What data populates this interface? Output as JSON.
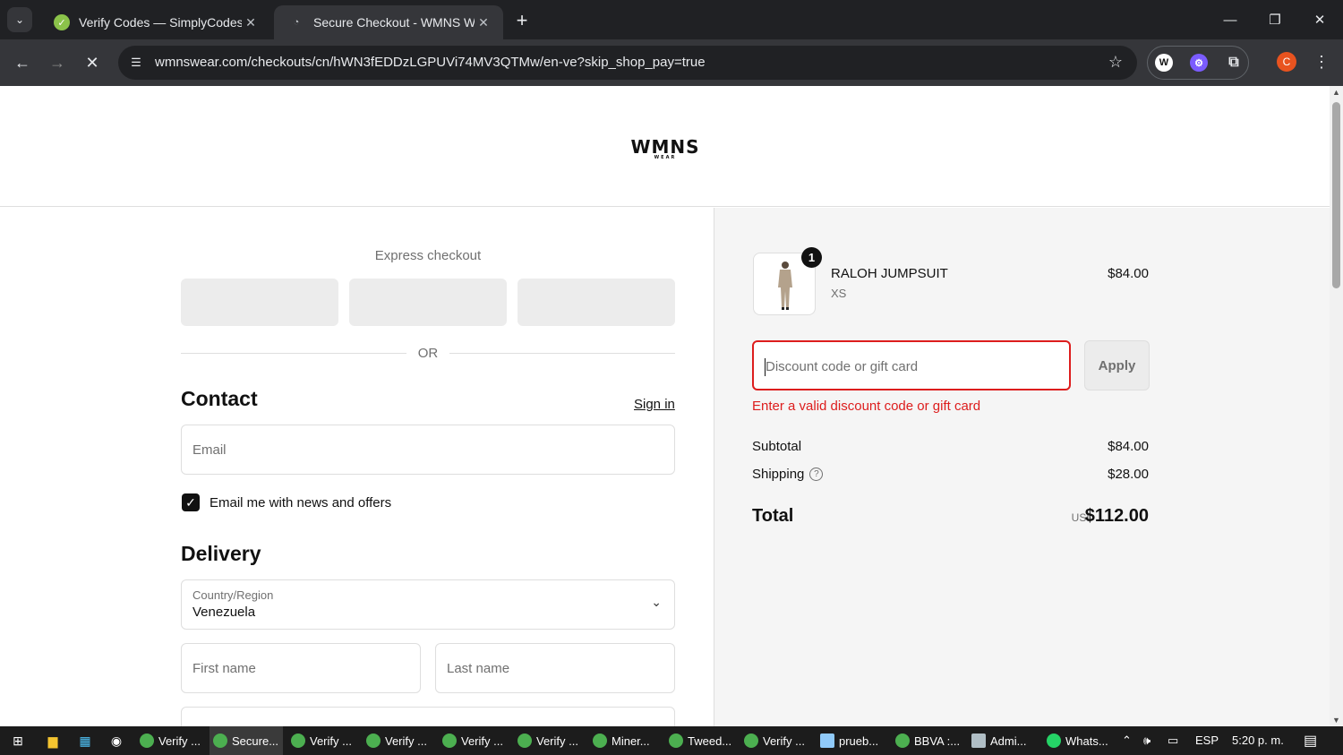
{
  "browser": {
    "tabs": [
      {
        "title": "Verify Codes — SimplyCodes",
        "active": false
      },
      {
        "title": "Secure Checkout - WMNS WEA",
        "active": true
      }
    ],
    "url": "wmnswear.com/checkouts/cn/hWN3fEDDzLGPUVi74MV3QTMw/en-ve?skip_shop_pay=true",
    "profile_initial": "C"
  },
  "store": {
    "logo": "WMNS",
    "logo_sub": "WEAR"
  },
  "express": {
    "title": "Express checkout",
    "or": "OR"
  },
  "contact": {
    "heading": "Contact",
    "signin": "Sign in",
    "email_placeholder": "Email",
    "newsletter_label": "Email me with news and offers",
    "newsletter_checked": true
  },
  "delivery": {
    "heading": "Delivery",
    "country_label": "Country/Region",
    "country_value": "Venezuela",
    "first_name_placeholder": "First name",
    "last_name_placeholder": "Last name"
  },
  "order": {
    "item": {
      "name": "RALOH JUMPSUIT",
      "variant": "XS",
      "price": "$84.00",
      "quantity": "1"
    },
    "discount_placeholder": "Discount code or gift card",
    "apply_label": "Apply",
    "error": "Enter a valid discount code or gift card",
    "subtotal_label": "Subtotal",
    "subtotal_value": "$84.00",
    "shipping_label": "Shipping",
    "shipping_value": "$28.00",
    "total_label": "Total",
    "total_currency": "USD",
    "total_value": "$112.00"
  },
  "taskbar": {
    "apps": [
      "Verify ...",
      "Secure...",
      "Verify ...",
      "Verify ...",
      "Verify ...",
      "Verify ...",
      "Miner...",
      "Tweed...",
      "Verify ...",
      "prueb...",
      "BBVA :...",
      "Admi...",
      "Whats..."
    ],
    "active_index": 1,
    "language": "ESP",
    "time": "5:20 p. m."
  },
  "colors": {
    "error": "#dd1d1d",
    "accent": "#111111",
    "sidebar_bg": "#f5f5f5"
  }
}
